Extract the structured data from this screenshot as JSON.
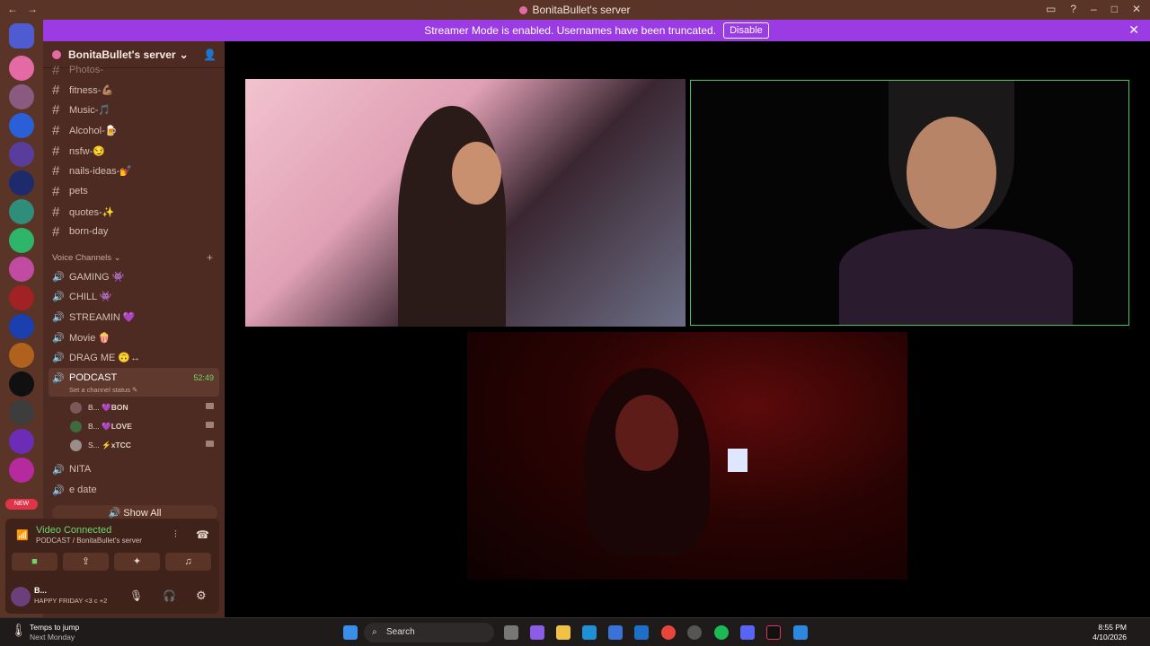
{
  "window": {
    "title": "BonitaBullet's server",
    "back": "←",
    "forward": "→"
  },
  "banner": {
    "text": "Streamer Mode is enabled. Usernames have been truncated.",
    "disable_label": "Disable",
    "close": "✕"
  },
  "guilds": {
    "new_label": "NEW"
  },
  "server": {
    "name": "BonitaBullet's server"
  },
  "text_channels": [
    {
      "name": "Photos-"
    },
    {
      "name": "fitness-💪🏽"
    },
    {
      "name": "Music-🎵"
    },
    {
      "name": "Alcohol-🍺"
    },
    {
      "name": "nsfw-😏"
    },
    {
      "name": "nails-ideas-💅"
    },
    {
      "name": "pets"
    },
    {
      "name": "quotes-✨"
    },
    {
      "name": "born-day"
    }
  ],
  "voice_category": "Voice Channels",
  "voice_channels": [
    {
      "name": "GAMING 👾"
    },
    {
      "name": "CHILL 👾"
    },
    {
      "name": "STREAMIN 💜"
    },
    {
      "name": "Movie 🍿"
    },
    {
      "name": "DRAG ME 🙃↔"
    }
  ],
  "active_voice": {
    "name": "PODCAST",
    "timer": "52:49",
    "status": "Set a channel status ✎"
  },
  "voice_users": [
    {
      "name": "B...",
      "tag": "💜BON"
    },
    {
      "name": "B...",
      "tag": "💜LOVE"
    },
    {
      "name": "S...",
      "tag": "⚡xTCC"
    }
  ],
  "more_voice": [
    {
      "name": "NITA"
    },
    {
      "name": "e date"
    }
  ],
  "show_all": "Show All",
  "voice_panel": {
    "connected": "Video Connected",
    "location": "PODCAST / BonitaBullet's server"
  },
  "user": {
    "name": "B...",
    "status": "HAPPY FRIDAY <3 c +2"
  },
  "taskbar": {
    "weather_line1": "Temps to jump",
    "weather_line2": "Next Monday",
    "search": "Search",
    "time": "8:55 PM",
    "date": "4/10/2026"
  }
}
